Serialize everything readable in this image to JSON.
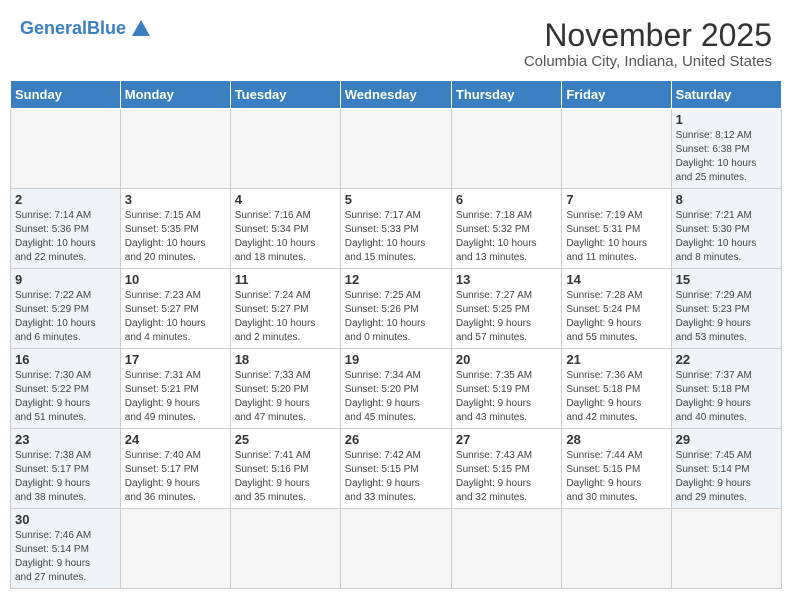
{
  "header": {
    "logo_line1": "General",
    "logo_line2": "Blue",
    "title": "November 2025",
    "subtitle": "Columbia City, Indiana, United States"
  },
  "weekdays": [
    "Sunday",
    "Monday",
    "Tuesday",
    "Wednesday",
    "Thursday",
    "Friday",
    "Saturday"
  ],
  "weeks": [
    [
      {
        "num": "",
        "info": "",
        "empty": true
      },
      {
        "num": "",
        "info": "",
        "empty": true
      },
      {
        "num": "",
        "info": "",
        "empty": true
      },
      {
        "num": "",
        "info": "",
        "empty": true
      },
      {
        "num": "",
        "info": "",
        "empty": true
      },
      {
        "num": "",
        "info": "",
        "empty": true
      },
      {
        "num": "1",
        "info": "Sunrise: 8:12 AM\nSunset: 6:38 PM\nDaylight: 10 hours\nand 25 minutes."
      }
    ],
    [
      {
        "num": "2",
        "info": "Sunrise: 7:14 AM\nSunset: 5:36 PM\nDaylight: 10 hours\nand 22 minutes."
      },
      {
        "num": "3",
        "info": "Sunrise: 7:15 AM\nSunset: 5:35 PM\nDaylight: 10 hours\nand 20 minutes."
      },
      {
        "num": "4",
        "info": "Sunrise: 7:16 AM\nSunset: 5:34 PM\nDaylight: 10 hours\nand 18 minutes."
      },
      {
        "num": "5",
        "info": "Sunrise: 7:17 AM\nSunset: 5:33 PM\nDaylight: 10 hours\nand 15 minutes."
      },
      {
        "num": "6",
        "info": "Sunrise: 7:18 AM\nSunset: 5:32 PM\nDaylight: 10 hours\nand 13 minutes."
      },
      {
        "num": "7",
        "info": "Sunrise: 7:19 AM\nSunset: 5:31 PM\nDaylight: 10 hours\nand 11 minutes."
      },
      {
        "num": "8",
        "info": "Sunrise: 7:21 AM\nSunset: 5:30 PM\nDaylight: 10 hours\nand 8 minutes."
      }
    ],
    [
      {
        "num": "9",
        "info": "Sunrise: 7:22 AM\nSunset: 5:29 PM\nDaylight: 10 hours\nand 6 minutes."
      },
      {
        "num": "10",
        "info": "Sunrise: 7:23 AM\nSunset: 5:27 PM\nDaylight: 10 hours\nand 4 minutes."
      },
      {
        "num": "11",
        "info": "Sunrise: 7:24 AM\nSunset: 5:27 PM\nDaylight: 10 hours\nand 2 minutes."
      },
      {
        "num": "12",
        "info": "Sunrise: 7:25 AM\nSunset: 5:26 PM\nDaylight: 10 hours\nand 0 minutes."
      },
      {
        "num": "13",
        "info": "Sunrise: 7:27 AM\nSunset: 5:25 PM\nDaylight: 9 hours\nand 57 minutes."
      },
      {
        "num": "14",
        "info": "Sunrise: 7:28 AM\nSunset: 5:24 PM\nDaylight: 9 hours\nand 55 minutes."
      },
      {
        "num": "15",
        "info": "Sunrise: 7:29 AM\nSunset: 5:23 PM\nDaylight: 9 hours\nand 53 minutes."
      }
    ],
    [
      {
        "num": "16",
        "info": "Sunrise: 7:30 AM\nSunset: 5:22 PM\nDaylight: 9 hours\nand 51 minutes."
      },
      {
        "num": "17",
        "info": "Sunrise: 7:31 AM\nSunset: 5:21 PM\nDaylight: 9 hours\nand 49 minutes."
      },
      {
        "num": "18",
        "info": "Sunrise: 7:33 AM\nSunset: 5:20 PM\nDaylight: 9 hours\nand 47 minutes."
      },
      {
        "num": "19",
        "info": "Sunrise: 7:34 AM\nSunset: 5:20 PM\nDaylight: 9 hours\nand 45 minutes."
      },
      {
        "num": "20",
        "info": "Sunrise: 7:35 AM\nSunset: 5:19 PM\nDaylight: 9 hours\nand 43 minutes."
      },
      {
        "num": "21",
        "info": "Sunrise: 7:36 AM\nSunset: 5:18 PM\nDaylight: 9 hours\nand 42 minutes."
      },
      {
        "num": "22",
        "info": "Sunrise: 7:37 AM\nSunset: 5:18 PM\nDaylight: 9 hours\nand 40 minutes."
      }
    ],
    [
      {
        "num": "23",
        "info": "Sunrise: 7:38 AM\nSunset: 5:17 PM\nDaylight: 9 hours\nand 38 minutes."
      },
      {
        "num": "24",
        "info": "Sunrise: 7:40 AM\nSunset: 5:17 PM\nDaylight: 9 hours\nand 36 minutes."
      },
      {
        "num": "25",
        "info": "Sunrise: 7:41 AM\nSunset: 5:16 PM\nDaylight: 9 hours\nand 35 minutes."
      },
      {
        "num": "26",
        "info": "Sunrise: 7:42 AM\nSunset: 5:15 PM\nDaylight: 9 hours\nand 33 minutes."
      },
      {
        "num": "27",
        "info": "Sunrise: 7:43 AM\nSunset: 5:15 PM\nDaylight: 9 hours\nand 32 minutes."
      },
      {
        "num": "28",
        "info": "Sunrise: 7:44 AM\nSunset: 5:15 PM\nDaylight: 9 hours\nand 30 minutes."
      },
      {
        "num": "29",
        "info": "Sunrise: 7:45 AM\nSunset: 5:14 PM\nDaylight: 9 hours\nand 29 minutes."
      }
    ],
    [
      {
        "num": "30",
        "info": "Sunrise: 7:46 AM\nSunset: 5:14 PM\nDaylight: 9 hours\nand 27 minutes."
      },
      {
        "num": "",
        "info": "",
        "empty": true
      },
      {
        "num": "",
        "info": "",
        "empty": true
      },
      {
        "num": "",
        "info": "",
        "empty": true
      },
      {
        "num": "",
        "info": "",
        "empty": true
      },
      {
        "num": "",
        "info": "",
        "empty": true
      },
      {
        "num": "",
        "info": "",
        "empty": true
      }
    ]
  ]
}
